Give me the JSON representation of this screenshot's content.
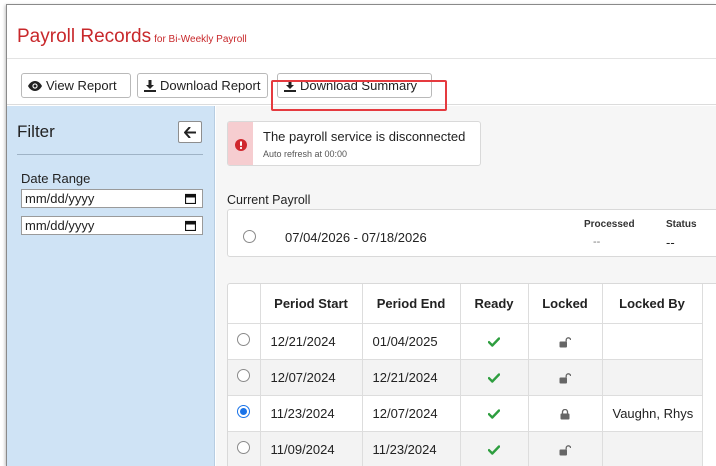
{
  "header": {
    "title": "Payroll Records",
    "subtitle": "for Bi-Weekly Payroll"
  },
  "toolbar": {
    "view_report": "View Report",
    "download_report": "Download Report",
    "download_summary": "Download Summary"
  },
  "filter": {
    "title": "Filter",
    "date_range_label": "Date Range",
    "start_placeholder": "mm/dd/yyyy",
    "end_placeholder": "mm/dd/yyyy"
  },
  "alert": {
    "message": "The payroll service is disconnected",
    "sub": "Auto refresh at 00:00"
  },
  "current_payroll": {
    "label": "Current Payroll",
    "range": "07/04/2026 - 07/18/2026",
    "processed_header": "Processed",
    "processed_value": "--",
    "status_header": "Status",
    "status_value": "--"
  },
  "table": {
    "columns": [
      "",
      "Period Start",
      "Period End",
      "Ready",
      "Locked",
      "Locked By"
    ],
    "rows": [
      {
        "start": "12/21/2024",
        "end": "01/04/2025",
        "ready": true,
        "locked": false,
        "locked_by": "",
        "selected": false
      },
      {
        "start": "12/07/2024",
        "end": "12/21/2024",
        "ready": true,
        "locked": false,
        "locked_by": "",
        "selected": false
      },
      {
        "start": "11/23/2024",
        "end": "12/07/2024",
        "ready": true,
        "locked": true,
        "locked_by": "Vaughn, Rhys",
        "selected": true
      },
      {
        "start": "11/09/2024",
        "end": "11/23/2024",
        "ready": true,
        "locked": false,
        "locked_by": "",
        "selected": false
      }
    ]
  },
  "icons": {
    "view": "eye-icon",
    "download": "download-icon",
    "collapse": "arrow-left-icon",
    "alert": "exclamation-circle-icon",
    "calendar": "calendar-icon",
    "ready": "checkmark-icon",
    "unlocked": "unlock-icon",
    "locked": "lock-icon"
  },
  "colors": {
    "title": "#c8282b",
    "sidebar": "#cfe3f5",
    "highlight": "#e53a3f",
    "check": "#2e9e3f",
    "radio_selected": "#1a73e8"
  }
}
